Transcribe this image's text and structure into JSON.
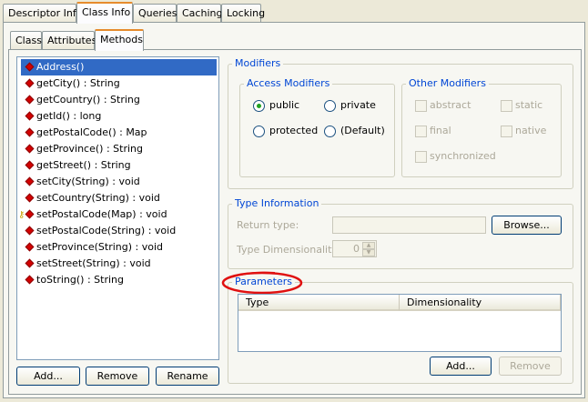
{
  "top_tabs": [
    "Descriptor Info",
    "Class Info",
    "Queries",
    "Caching",
    "Locking"
  ],
  "sub_tabs": [
    "Class",
    "Attributes",
    "Methods"
  ],
  "methods": [
    "Address()",
    "getCity() : String",
    "getCountry() : String",
    "getId() : long",
    "getPostalCode() : Map",
    "getProvince() : String",
    "getStreet() : String",
    "setCity(String) : void",
    "setCountry(String) : void",
    "setPostalCode(Map) : void",
    "setPostalCode(String) : void",
    "setProvince(String) : void",
    "setStreet(String) : void",
    "toString() : String"
  ],
  "list_buttons": {
    "add": "Add...",
    "remove": "Remove",
    "rename": "Rename"
  },
  "modifiers": {
    "title": "Modifiers",
    "access": {
      "title": "Access Modifiers",
      "public": "public",
      "private": "private",
      "protected": "protected",
      "default": "(Default)"
    },
    "other": {
      "title": "Other Modifiers",
      "abstract": "abstract",
      "static": "static",
      "final": "final",
      "native": "native",
      "synchronized": "synchronized"
    }
  },
  "type_info": {
    "title": "Type Information",
    "return_type_label": "Return type:",
    "browse": "Browse...",
    "dimensionality_label": "Type Dimensionality:",
    "dimensionality_value": "0"
  },
  "parameters": {
    "title": "Parameters",
    "col_type": "Type",
    "col_dim": "Dimensionality",
    "add": "Add...",
    "remove": "Remove"
  },
  "colors": {
    "accent": "#e68b2c",
    "selection": "#316ac5",
    "group_title": "#0046d5",
    "annotation": "#e01010"
  }
}
